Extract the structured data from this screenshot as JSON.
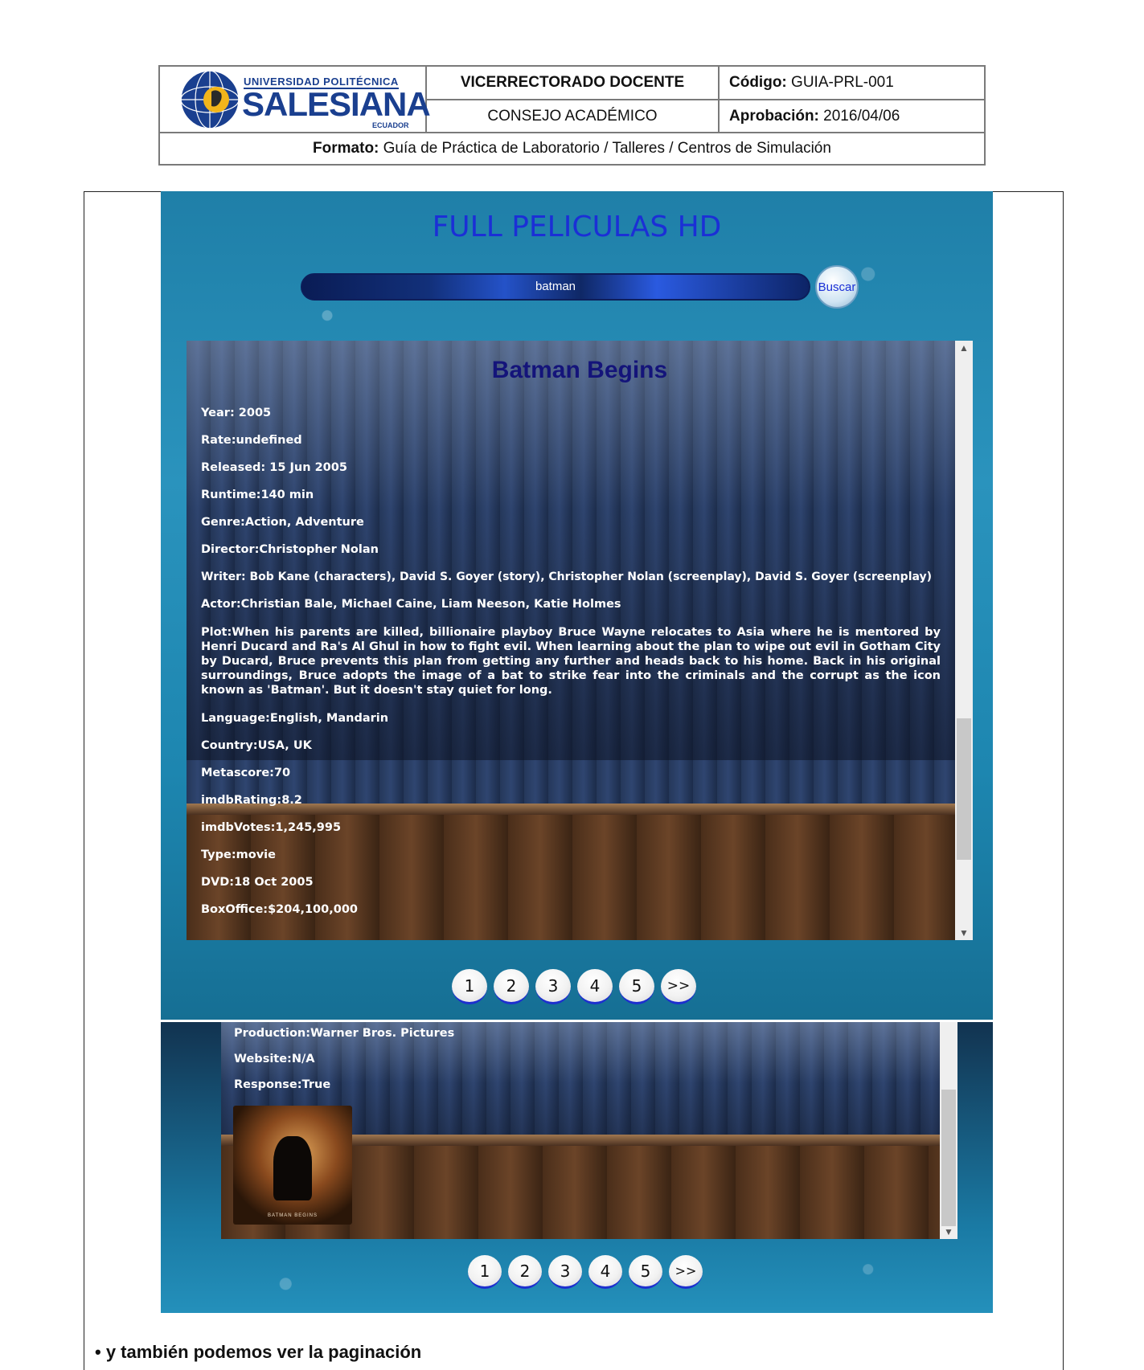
{
  "header": {
    "logo": {
      "top_line": "UNIVERSIDAD POLITÉCNICA",
      "name": "SALESIANA",
      "country": "ECUADOR"
    },
    "vicerrectorado": "VICERRECTORADO DOCENTE",
    "codigo_label": "Código:",
    "codigo_value": "GUIA-PRL-001",
    "consejo": "CONSEJO ACADÉMICO",
    "aprobacion_label": "Aprobación:",
    "aprobacion_value": "2016/04/06",
    "formato_label": "Formato:",
    "formato_value": "Guía de Práctica de Laboratorio / Talleres / Centros de Simulación"
  },
  "app": {
    "title": "FULL PELICULAS HD",
    "search_value": "batman",
    "search_button": "Buscar",
    "movie": {
      "title": "Batman Begins",
      "year": "Year: 2005",
      "rate": "Rate:undefined",
      "released": "Released: 15 Jun 2005",
      "runtime": "Runtime:140 min",
      "genre": "Genre:Action, Adventure",
      "director": "Director:Christopher Nolan",
      "writer": "Writer: Bob Kane (characters), David S. Goyer (story), Christopher Nolan (screenplay), David S. Goyer (screenplay)",
      "actor": "Actor:Christian Bale, Michael Caine, Liam Neeson, Katie Holmes",
      "plot": "Plot:When his parents are killed, billionaire playboy Bruce Wayne relocates to Asia where he is mentored by Henri Ducard and Ra's Al Ghul in how to fight evil. When learning about the plan to wipe out evil in Gotham City by Ducard, Bruce prevents this plan from getting any further and heads back to his home. Back in his original surroundings, Bruce adopts the image of a bat to strike fear into the criminals and the corrupt as the icon known as 'Batman'. But it doesn't stay quiet for long.",
      "language": "Language:English, Mandarin",
      "country": "Country:USA, UK",
      "metascore": "Metascore:70",
      "imdb_rating": "imdbRating:8.2",
      "imdb_votes": "imdbVotes:1,245,995",
      "type": "Type:movie",
      "dvd": "DVD:18 Oct 2005",
      "box_office": "BoxOffice:$204,100,000",
      "production": "Production:Warner Bros. Pictures",
      "website": "Website:N/A",
      "response": "Response:True",
      "poster_caption": "BATMAN BEGINS"
    },
    "pagination": [
      "1",
      "2",
      "3",
      "4",
      "5",
      ">>"
    ]
  },
  "caption": "• y también podemos ver la paginación"
}
